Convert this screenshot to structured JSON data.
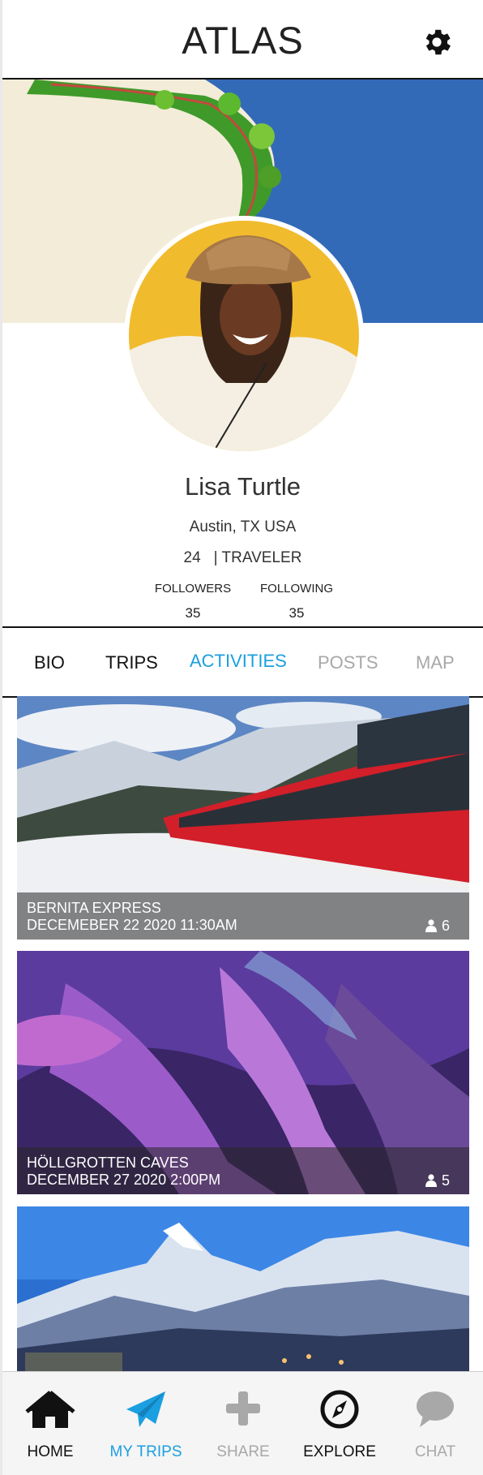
{
  "app": {
    "title": "ATLAS"
  },
  "profile": {
    "name": "Lisa Turtle",
    "location": "Austin, TX USA",
    "age": "24",
    "role": "| TRAVELER",
    "followers_label": "FOLLOWERS",
    "followers_count": "35",
    "following_label": "FOLLOWING",
    "following_count": "35"
  },
  "tabs": [
    {
      "label": "BIO",
      "state": "normal"
    },
    {
      "label": "TRIPS",
      "state": "normal"
    },
    {
      "label": "ACTIVITIES",
      "state": "active"
    },
    {
      "label": "POSTS",
      "state": "muted"
    },
    {
      "label": "MAP",
      "state": "muted"
    }
  ],
  "activities": [
    {
      "title": "BERNITA EXPRESS",
      "date": "DECEMEBER 22 2020 11:30AM",
      "count": "6"
    },
    {
      "title": "HÖLLGROTTEN CAVES",
      "date": "DECEMBER 27 2020 2:00PM",
      "count": "5"
    },
    {
      "title": "",
      "date": "",
      "count": ""
    }
  ],
  "nav": [
    {
      "label": "HOME",
      "icon": "home-icon"
    },
    {
      "label": "MY TRIPS",
      "icon": "paper-plane-icon"
    },
    {
      "label": "SHARE",
      "icon": "plus-icon"
    },
    {
      "label": "EXPLORE",
      "icon": "compass-icon"
    },
    {
      "label": "CHAT",
      "icon": "chat-bubble-icon"
    }
  ],
  "colors": {
    "accent": "#1a9fe0",
    "muted": "#a8a8a8",
    "text": "#111111"
  }
}
